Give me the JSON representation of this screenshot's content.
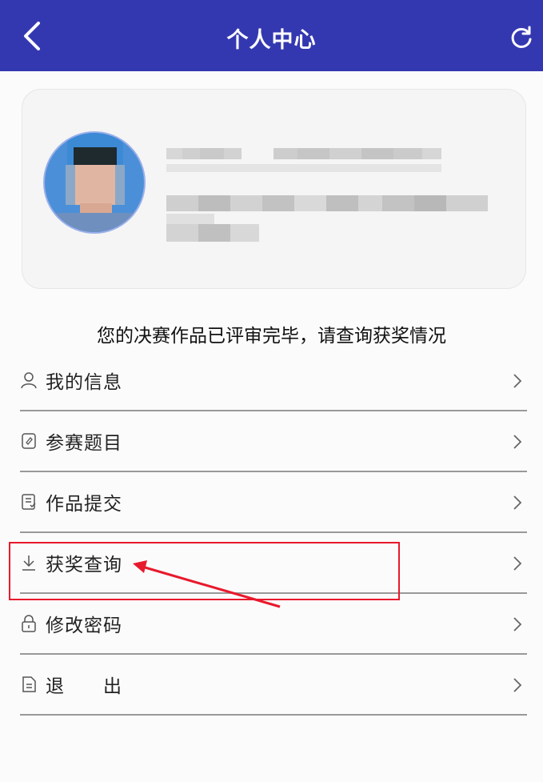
{
  "header": {
    "title": "个人中心",
    "back_icon": "chevron-left-icon",
    "refresh_icon": "refresh-icon",
    "background": "#3438b0"
  },
  "profile": {
    "avatar_icon": "user-avatar",
    "name_blurred": true,
    "details_blurred": true
  },
  "notice": "您的决赛作品已评审完毕，请查询获奖情况",
  "menu": {
    "items": [
      {
        "label": "我的信息",
        "icon": "user-icon"
      },
      {
        "label": "参赛题目",
        "icon": "document-icon"
      },
      {
        "label": "作品提交",
        "icon": "submit-icon"
      },
      {
        "label": "获奖查询",
        "icon": "download-icon"
      },
      {
        "label": "修改密码",
        "icon": "lock-icon"
      },
      {
        "label": "退　　出",
        "icon": "logout-icon"
      }
    ]
  },
  "annotation": {
    "highlight_color": "#e8192c"
  }
}
